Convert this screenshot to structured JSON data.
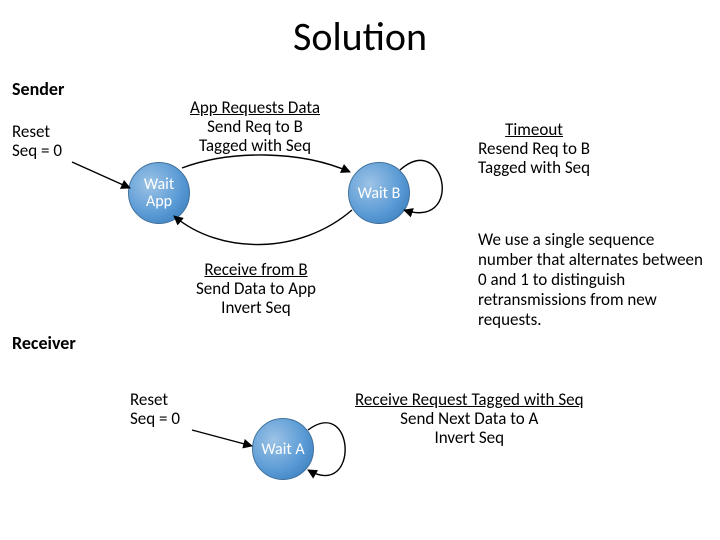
{
  "title": "Solution",
  "sections": {
    "sender": "Sender",
    "receiver": "Receiver"
  },
  "states": {
    "wait_app": {
      "l1": "Wait",
      "l2": "App"
    },
    "wait_b": {
      "l1": "Wait B"
    },
    "wait_a": {
      "l1": "Wait A"
    }
  },
  "labels": {
    "reset1": {
      "l1": "Reset",
      "l2": "Seq = 0"
    },
    "app_req": {
      "u": "App Requests Data",
      "l2": "Send Req to B",
      "l3": "Tagged with Seq"
    },
    "timeout": {
      "u": "Timeout",
      "l2": "Resend Req to B",
      "l3": "Tagged with  Seq"
    },
    "recv_b": {
      "u": "Receive from B",
      "l2": "Send Data to App",
      "l3": "Invert Seq"
    },
    "reset2": {
      "l1": "Reset",
      "l2": "Seq = 0"
    },
    "recv_req": {
      "u": "Receive Request Tagged with Seq",
      "l2": "Send Next Data to A",
      "l3": "Invert Seq"
    }
  },
  "explanation": "We use a single sequence number that alternates between 0 and 1 to distinguish retransmissions from new requests."
}
